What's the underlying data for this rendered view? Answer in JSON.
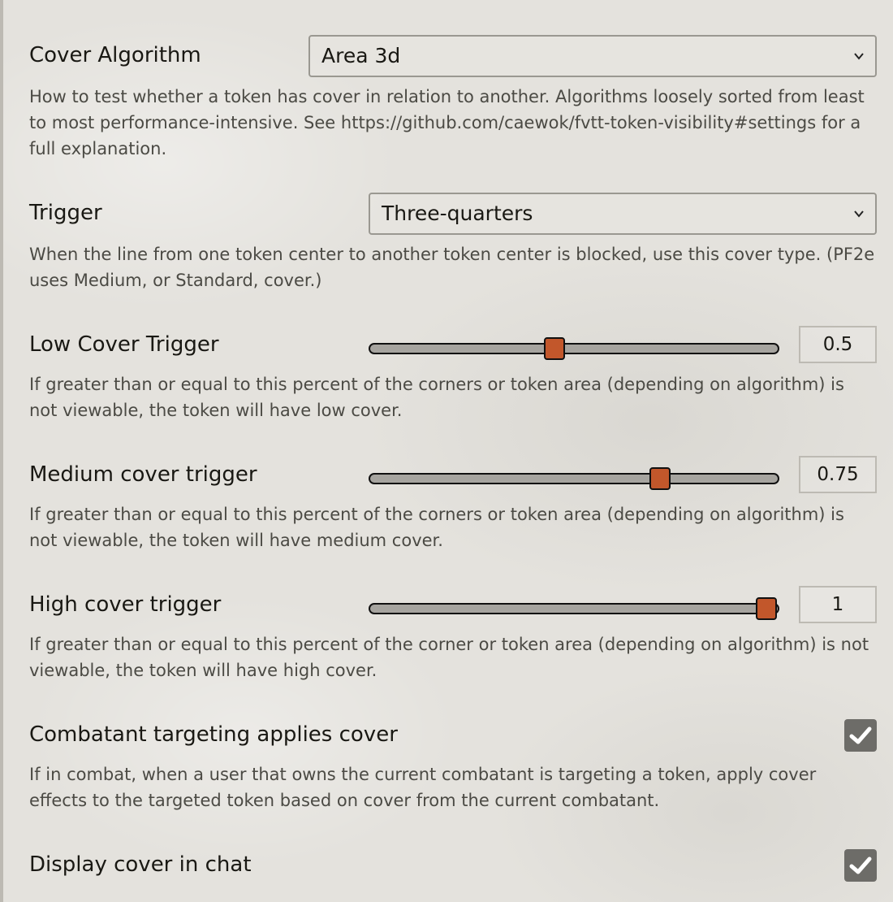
{
  "settings": [
    {
      "label": "Cover Algorithm",
      "type": "select",
      "value": "Area 3d",
      "notes": "How to test whether a token has cover in relation to another. Algorithms loosely sorted from least to most performance-intensive. See https://github.com/caewok/fvtt-token-visibility#settings for a full explanation."
    },
    {
      "label": "Trigger",
      "type": "select",
      "value": "Three-quarters",
      "notes": "When the line from one token center to another token center is blocked, use this cover type. (PF2e uses Medium, or Standard, cover.)"
    },
    {
      "label": "Low Cover Trigger",
      "type": "range",
      "value": "0.5",
      "range_min": 0,
      "range_max": 1,
      "thumb_fraction": 0.45,
      "notes": "If greater than or equal to this percent of the corners or token area (depending on algorithm) is not viewable, the token will have low cover."
    },
    {
      "label": "Medium cover trigger",
      "type": "range",
      "value": "0.75",
      "range_min": 0,
      "range_max": 1,
      "thumb_fraction": 0.71,
      "notes": "If greater than or equal to this percent of the corners or token area (depending on algorithm) is not viewable, the token will have medium cover."
    },
    {
      "label": "High cover trigger",
      "type": "range",
      "value": "1",
      "range_min": 0,
      "range_max": 1,
      "thumb_fraction": 0.97,
      "notes": "If greater than or equal to this percent of the corner or token area (depending on algorithm) is not viewable, the token will have high cover."
    },
    {
      "label": "Combatant targeting applies cover",
      "type": "checkbox",
      "checked": true,
      "notes": "If in combat, when a user that owns the current combatant is targeting a token, apply cover effects to the targeted token based on cover from the current combatant."
    },
    {
      "label": "Display cover in chat",
      "type": "checkbox",
      "checked": true,
      "notes": ""
    }
  ],
  "colors": {
    "thumb": "#c2572b",
    "track": "#a6a49f",
    "checkbox": "#6d6c68"
  }
}
